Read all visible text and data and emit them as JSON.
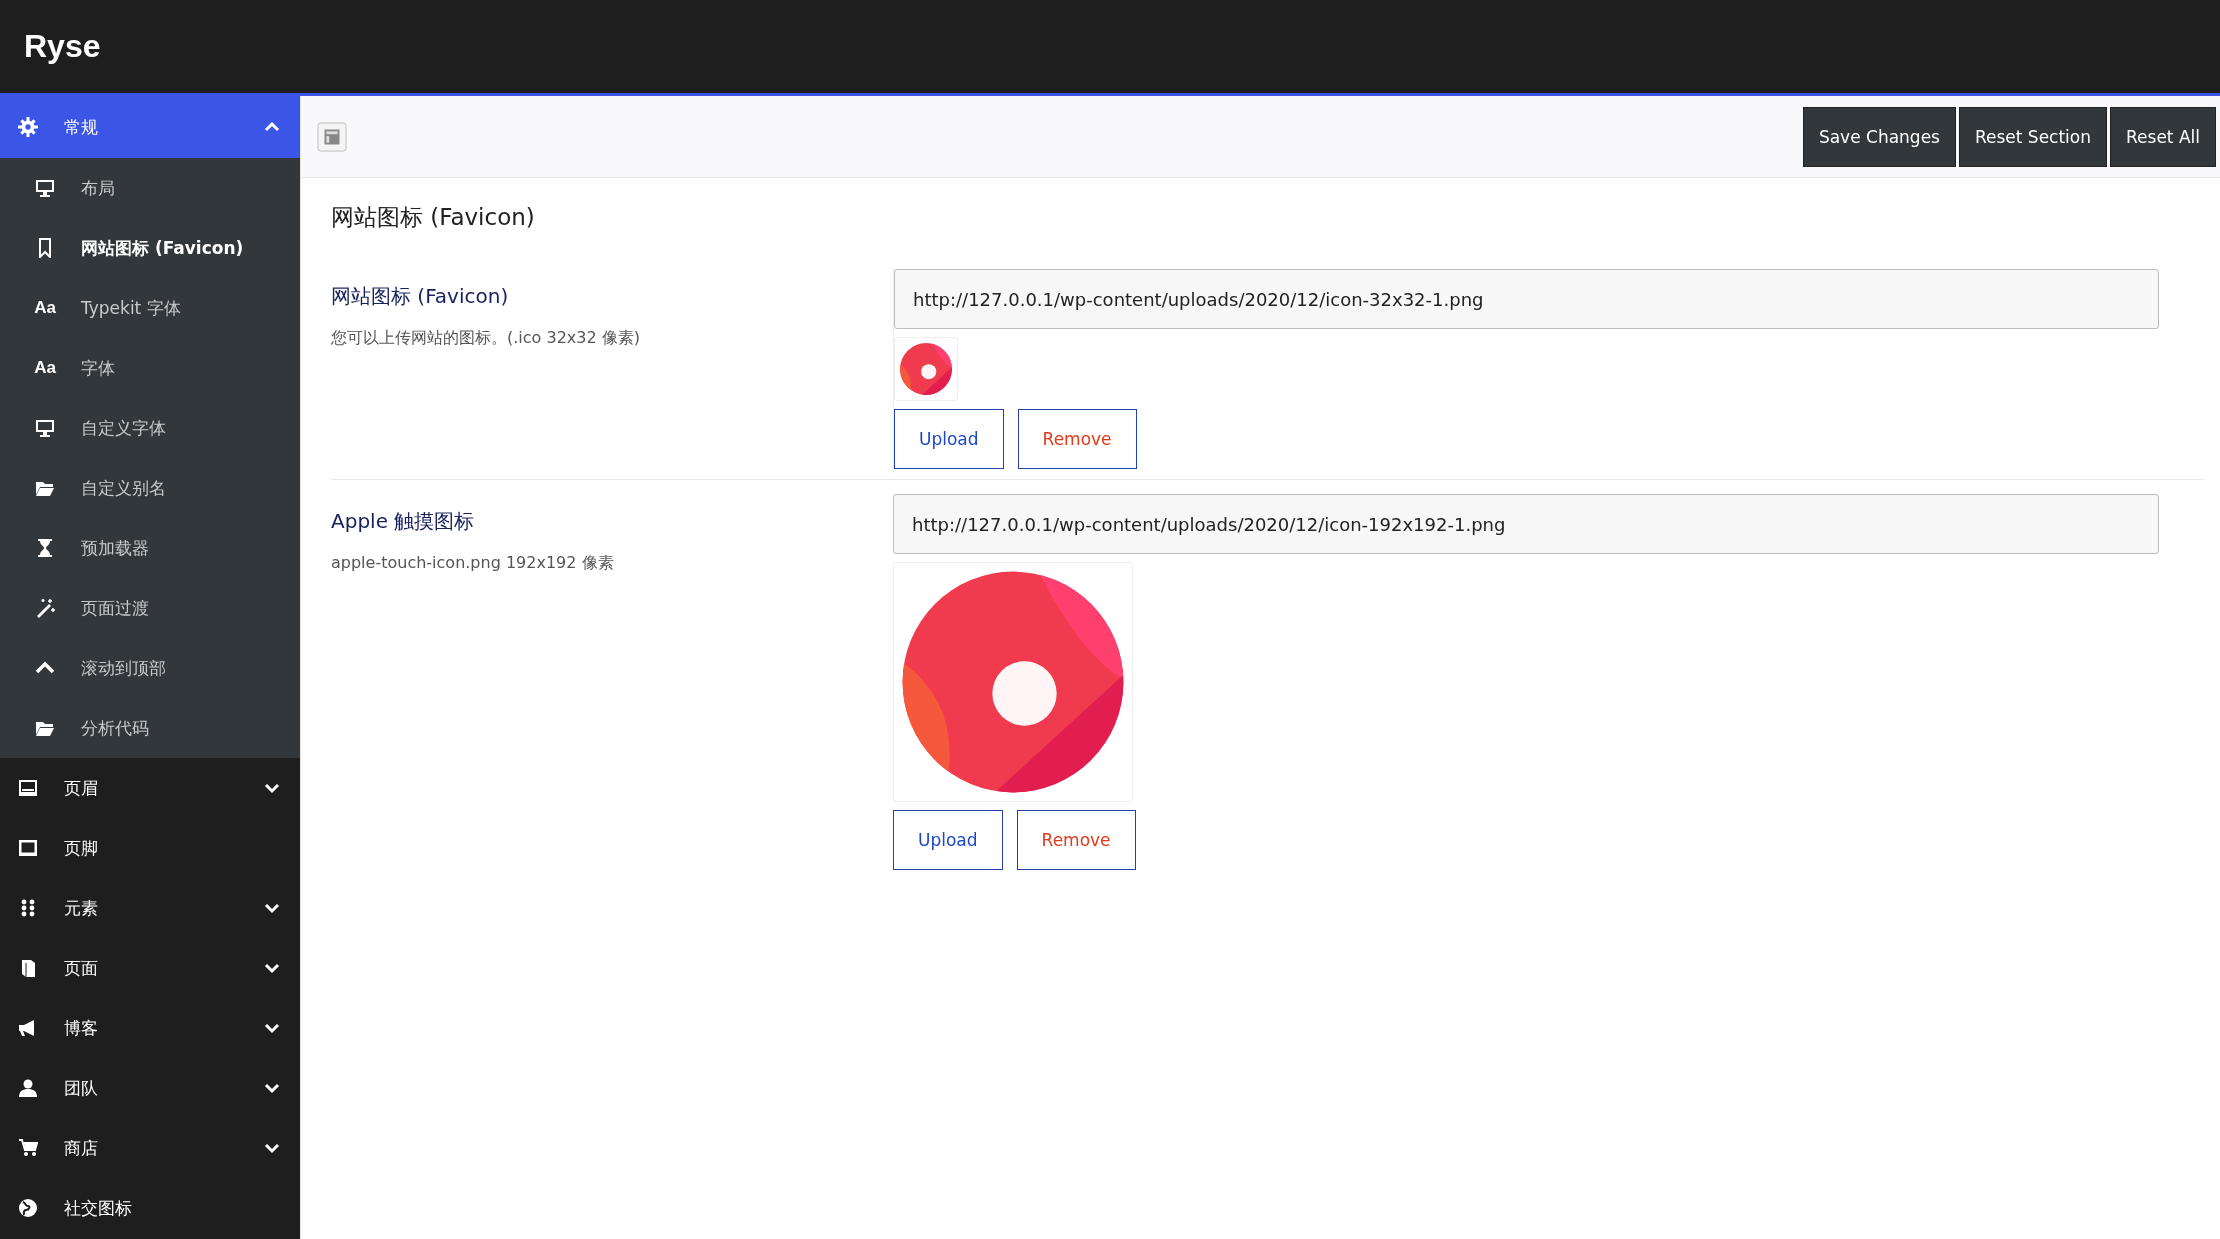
{
  "app": {
    "title": "Ryse"
  },
  "sidebar": {
    "items": [
      {
        "label": "常规",
        "selected": true,
        "expanded": true,
        "children": [
          {
            "label": "布局",
            "selected": false
          },
          {
            "label": "网站图标 (Favicon)",
            "selected": true
          },
          {
            "label": "Typekit 字体",
            "selected": false,
            "icon_text": "Aa"
          },
          {
            "label": "字体",
            "selected": false,
            "icon_text": "Aa"
          },
          {
            "label": "自定义字体",
            "selected": false
          },
          {
            "label": "自定义别名",
            "selected": false
          },
          {
            "label": "预加载器",
            "selected": false
          },
          {
            "label": "页面过渡",
            "selected": false
          },
          {
            "label": "滚动到顶部",
            "selected": false
          },
          {
            "label": "分析代码",
            "selected": false
          }
        ]
      },
      {
        "label": "页眉",
        "selected": false,
        "expanded": false
      },
      {
        "label": "页脚",
        "selected": false
      },
      {
        "label": "元素",
        "selected": false,
        "expanded": false
      },
      {
        "label": "页面",
        "selected": false,
        "expanded": false
      },
      {
        "label": "博客",
        "selected": false,
        "expanded": false
      },
      {
        "label": "团队",
        "selected": false,
        "expanded": false
      },
      {
        "label": "商店",
        "selected": false,
        "expanded": false
      },
      {
        "label": "社交图标",
        "selected": false
      }
    ]
  },
  "toolbar": {
    "buttons": [
      "Save Changes",
      "Reset Section",
      "Reset All"
    ]
  },
  "section": {
    "title": "网站图标 (Favicon)",
    "fields": [
      {
        "label": "网站图标 (Favicon)",
        "description": "您可以上传网站的图标。(.ico 32x32 像素)",
        "value": "http://127.0.0.1/wp-content/uploads/2020/12/icon-32x32-1.png",
        "kind": "small",
        "buttons": [
          {
            "label": "Upload",
            "kind": "upload"
          },
          {
            "label": "Remove",
            "kind": "remove"
          }
        ]
      },
      {
        "label": "Apple 触摸图标",
        "description": "apple-touch-icon.png 192x192 像素",
        "value": "http://127.0.0.1/wp-content/uploads/2020/12/icon-192x192-1.png",
        "kind": "large",
        "buttons": [
          {
            "label": "Upload",
            "kind": "upload"
          },
          {
            "label": "Remove",
            "kind": "remove"
          }
        ]
      }
    ]
  }
}
